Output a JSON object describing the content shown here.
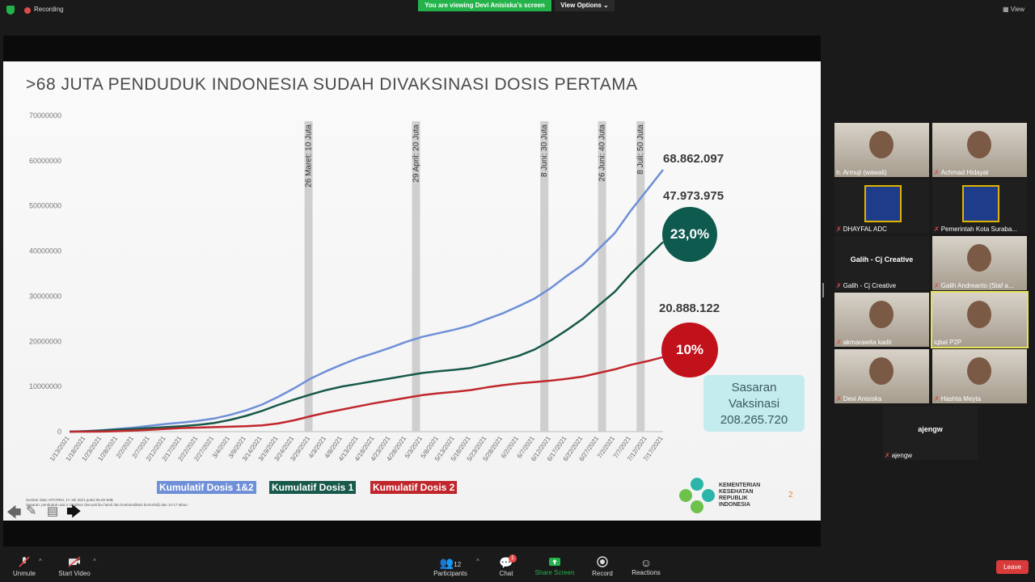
{
  "topbar": {
    "recording": "Recording",
    "viewing_banner": "You are viewing Devi Anisiska's screen",
    "view_options": "View Options",
    "view": "View"
  },
  "slide": {
    "title": ">68 JUTA PENDUDUK INDONESIA SUDAH DIVAKSINASI DOSIS PERTAMA",
    "total_label": "68.862.097",
    "dose1_label": "47.973.975",
    "dose2_label": "20.888.122",
    "dose1_pct": "23,0%",
    "dose2_pct": "10%",
    "target_line1": "Sasaran",
    "target_line2": "Vaksinasi",
    "target_line3": "208.265.720",
    "legend_total": "Kumulatif Dosis 1&2",
    "legend_dose1": "Kumulatif Dosis 1",
    "legend_dose2": "Kumulatif Dosis 2",
    "footnote1": "Sumber data: KPCPEN, 17 Juli 2021 pukul 06.00  WIB",
    "footnote2": "Sasaran: penduduk usia ≥ 18 tahun (kecuali ibu hamil dan kontraindikasi komorbid) dan 12-17 tahun",
    "kemenkes1": "KEMENTERIAN",
    "kemenkes2": "KESEHATAN",
    "kemenkes3": "REPUBLIK",
    "kemenkes4": "INDONESIA",
    "page_number": "2",
    "colors": {
      "total": "#6f8fd8",
      "dose1": "#17594a",
      "dose2": "#c0272d",
      "dose1_circle": "#0f5a4f",
      "dose2_circle": "#c1121c"
    }
  },
  "chart_data": {
    "type": "line",
    "ylim": [
      0,
      70000000
    ],
    "yticks": [
      "0",
      "10000000",
      "20000000",
      "30000000",
      "40000000",
      "50000000",
      "60000000",
      "70000000"
    ],
    "xlabels": [
      "1/13/2021",
      "1/18/2021",
      "1/23/2021",
      "1/28/2021",
      "2/2/2021",
      "2/7/2021",
      "2/12/2021",
      "2/17/2021",
      "2/22/2021",
      "2/27/2021",
      "3/4/2021",
      "3/9/2021",
      "3/14/2021",
      "3/19/2021",
      "3/24/2021",
      "3/29/2021",
      "4/3/2021",
      "4/8/2021",
      "4/13/2021",
      "4/18/2021",
      "4/23/2021",
      "4/28/2021",
      "5/3/2021",
      "5/8/2021",
      "5/13/2021",
      "5/18/2021",
      "5/23/2021",
      "5/28/2021",
      "6/2/2021",
      "6/7/2021",
      "6/12/2021",
      "6/17/2021",
      "6/22/2021",
      "6/27/2021",
      "7/2/2021",
      "7/7/2021",
      "7/12/2021",
      "7/17/2021"
    ],
    "milestones": [
      {
        "label": "26 Maret: 10 Juta",
        "x_index": 14.9
      },
      {
        "label": "29 April: 20 Juta",
        "x_index": 21.6
      },
      {
        "label": "8 Juni: 30 Juta",
        "x_index": 29.6
      },
      {
        "label": "26 Juni: 40 Juta",
        "x_index": 33.2
      },
      {
        "label": "8 Juli: 50 Juta",
        "x_index": 35.6
      }
    ],
    "series": [
      {
        "name": "Kumulatif Dosis 1&2",
        "color": "#6f8fd8",
        "values": [
          0,
          100000,
          300000,
          600000,
          900000,
          1300000,
          1700000,
          2000000,
          2400000,
          2900000,
          3700000,
          4700000,
          6000000,
          7700000,
          9600000,
          11700000,
          13400000,
          14900000,
          16300000,
          17400000,
          18600000,
          19900000,
          21000000,
          21800000,
          22600000,
          23500000,
          24900000,
          26200000,
          27800000,
          29500000,
          31800000,
          34500000,
          37000000,
          40500000,
          44000000,
          49000000,
          53500000,
          58000000
        ]
      },
      {
        "name": "Kumulatif Dosis 1",
        "color": "#17594a",
        "values": [
          0,
          90000,
          250000,
          450000,
          600000,
          800000,
          1000000,
          1200000,
          1500000,
          1900000,
          2600000,
          3500000,
          4600000,
          5900000,
          7100000,
          8200000,
          9200000,
          10000000,
          10600000,
          11200000,
          11800000,
          12400000,
          13000000,
          13400000,
          13700000,
          14100000,
          14900000,
          15800000,
          16800000,
          18200000,
          20200000,
          22500000,
          25000000,
          28000000,
          31000000,
          35000000,
          38500000,
          42000000
        ]
      },
      {
        "name": "Kumulatif Dosis 2",
        "color": "#c0272d",
        "values": [
          0,
          0,
          20000,
          100000,
          250000,
          400000,
          600000,
          800000,
          900000,
          1000000,
          1100000,
          1200000,
          1400000,
          1800000,
          2500000,
          3400000,
          4200000,
          4900000,
          5600000,
          6300000,
          6900000,
          7500000,
          8100000,
          8500000,
          8800000,
          9200000,
          9800000,
          10300000,
          10700000,
          11000000,
          11300000,
          11700000,
          12200000,
          13000000,
          13800000,
          14800000,
          15600000,
          16500000
        ]
      }
    ]
  },
  "participants": [
    {
      "name": "Ir. Armuji (wawali)",
      "muted": false,
      "kind": "video"
    },
    {
      "name": "Achmad Hidayat",
      "muted": true,
      "kind": "video"
    },
    {
      "name": "DHAYFAL ADC",
      "muted": true,
      "kind": "logo"
    },
    {
      "name": "Pemerintah Kota Suraba...",
      "muted": true,
      "kind": "logo"
    },
    {
      "name": "Galih - Cj Creative",
      "muted": true,
      "kind": "name",
      "display": "Galih - Cj Creative"
    },
    {
      "name": "Galih Andreanto (Staf a...",
      "muted": true,
      "kind": "video"
    },
    {
      "name": "akmarawita kadir",
      "muted": true,
      "kind": "video"
    },
    {
      "name": "iqbal P2P",
      "muted": false,
      "kind": "video",
      "active": true
    },
    {
      "name": "Devi Anisiska",
      "muted": true,
      "kind": "video"
    },
    {
      "name": "Hashta Meyta",
      "muted": true,
      "kind": "video"
    },
    {
      "name": "ajengw",
      "muted": true,
      "kind": "name",
      "display": "ajengw"
    }
  ],
  "toolbar": {
    "unmute": "Unmute",
    "start_video": "Start Video",
    "participants": "Participants",
    "participants_count": "12",
    "chat": "Chat",
    "chat_badge": "1",
    "share_screen": "Share Screen",
    "record": "Record",
    "reactions": "Reactions",
    "leave": "Leave"
  }
}
